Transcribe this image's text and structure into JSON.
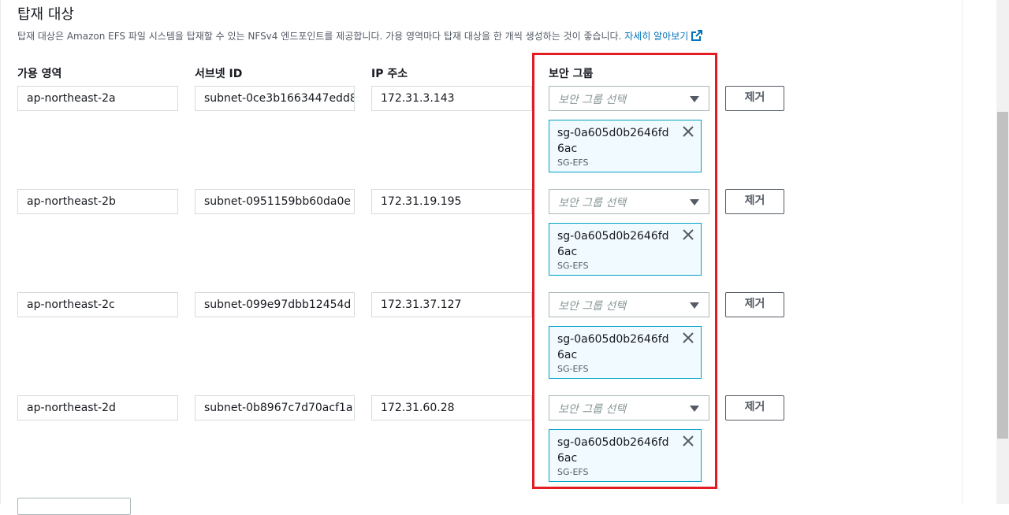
{
  "section": {
    "title": "탑재 대상",
    "description": "탑재 대상은 Amazon EFS 파일 시스템을 탑재할 수 있는 NFSv4 엔드포인트를 제공합니다. 가용 영역마다 탑재 대상을 한 개씩 생성하는 것이 좋습니다.",
    "learn_more": "자세히 알아보기"
  },
  "columns": {
    "az": "가용 영역",
    "subnet": "서브넷 ID",
    "ip": "IP 주소",
    "sg": "보안 그룹"
  },
  "select_placeholder": "보안 그룹 선택",
  "remove_label": "제거",
  "rows": [
    {
      "az": "ap-northeast-2a",
      "subnet": "subnet-0ce3b1663447edd8",
      "ip": "172.31.3.143",
      "sg_id": "sg-0a605d0b2646fd6ac",
      "sg_name": "SG-EFS"
    },
    {
      "az": "ap-northeast-2b",
      "subnet": "subnet-0951159bb60da0e",
      "ip": "172.31.19.195",
      "sg_id": "sg-0a605d0b2646fd6ac",
      "sg_name": "SG-EFS"
    },
    {
      "az": "ap-northeast-2c",
      "subnet": "subnet-099e97dbb12454d",
      "ip": "172.31.37.127",
      "sg_id": "sg-0a605d0b2646fd6ac",
      "sg_name": "SG-EFS"
    },
    {
      "az": "ap-northeast-2d",
      "subnet": "subnet-0b8967c7d70acf1a",
      "ip": "172.31.60.28",
      "sg_id": "sg-0a605d0b2646fd6ac",
      "sg_name": "SG-EFS"
    }
  ],
  "colors": {
    "highlight": "#e31b23",
    "token_border": "#00a1c9",
    "link": "#0073bb"
  },
  "icons": {
    "external": "external-link-icon",
    "dismiss": "close-icon",
    "dropdown": "caret-down-icon"
  }
}
